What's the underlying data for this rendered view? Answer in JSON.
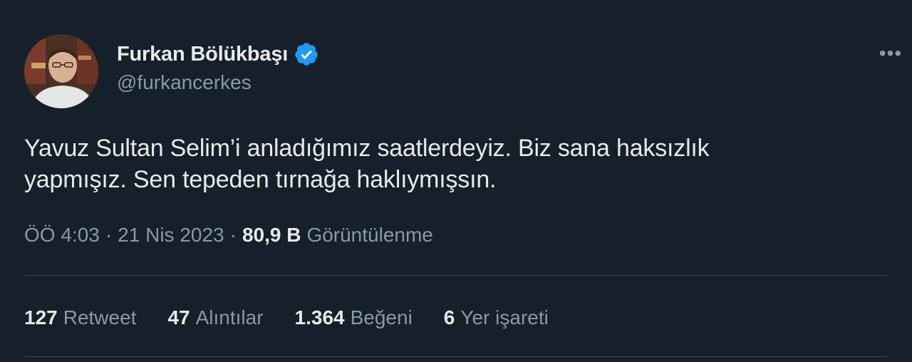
{
  "user": {
    "display_name": "Furkan Bölükbaşı",
    "handle": "@furkancerkes"
  },
  "more_icon": "•••",
  "tweet": {
    "text": "Yavuz Sultan Selim’i anladığımız saatlerdeyiz. Biz sana haksızlık\nyapmışız. Sen tepeden tırnağa haklıymışsın."
  },
  "meta": {
    "time": "ÖÖ 4:03",
    "separator": "·",
    "date": "21 Nis 2023",
    "views_count": "80,9 B",
    "views_label": "Görüntülenme"
  },
  "stats": [
    {
      "count": "127",
      "label": "Retweet"
    },
    {
      "count": "47",
      "label": "Alıntılar"
    },
    {
      "count": "1.364",
      "label": "Beğeni"
    },
    {
      "count": "6",
      "label": "Yer işareti"
    }
  ],
  "colors": {
    "background": "#15202b",
    "text_primary": "#e7e9ea",
    "text_secondary": "#8b98a5",
    "verified": "#1d9bf0",
    "divider": "#38444d"
  },
  "icons": {
    "verified": "verified-badge-icon",
    "more": "more-options-icon"
  }
}
